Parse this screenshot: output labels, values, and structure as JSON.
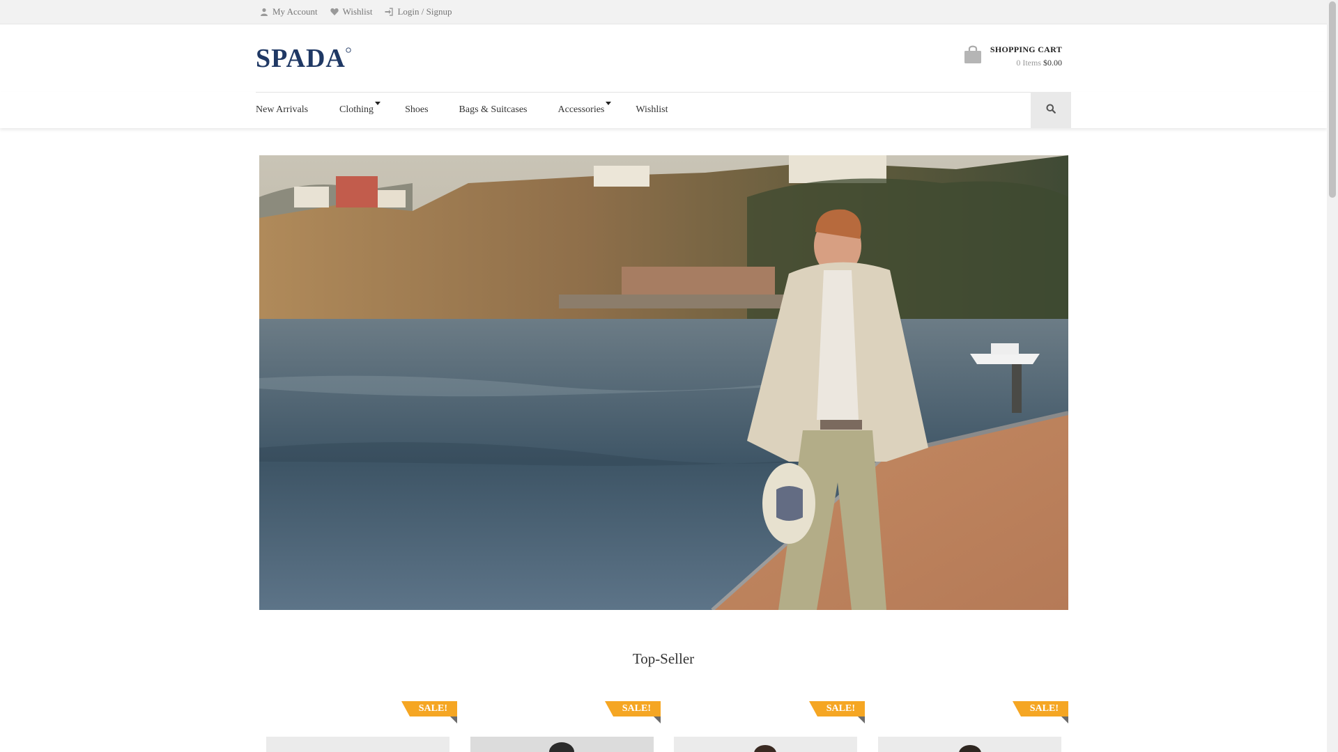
{
  "topbar": {
    "links": [
      {
        "label": "My Account",
        "icon": "user-icon"
      },
      {
        "label": "Wishlist",
        "icon": "heart-icon"
      },
      {
        "label": "Login / Signup",
        "icon": "sign-in-icon"
      }
    ]
  },
  "header": {
    "logo_text": "SPADA",
    "cart": {
      "title": "SHOPPING CART",
      "items": "0 Items",
      "total": "$0.00",
      "icon": "shopping-bag-icon"
    }
  },
  "nav": {
    "items": [
      {
        "label": "New Arrivals",
        "dropdown": false
      },
      {
        "label": "Clothing",
        "dropdown": true
      },
      {
        "label": "Shoes",
        "dropdown": false
      },
      {
        "label": "Bags & Suitcases",
        "dropdown": false
      },
      {
        "label": "Accessories",
        "dropdown": true
      },
      {
        "label": "Wishlist",
        "dropdown": false
      }
    ],
    "search_icon": "search-icon"
  },
  "hero": {
    "image": "man-in-linen-suit-on-pier"
  },
  "section": {
    "title": "Top-Seller"
  },
  "products": [
    {
      "badge": "SALE!"
    },
    {
      "badge": "SALE!"
    },
    {
      "badge": "SALE!"
    },
    {
      "badge": "SALE!"
    }
  ],
  "colors": {
    "sale_badge": "#f5a623",
    "logo": "#1f3864",
    "topbar_bg": "#f2f2f2"
  }
}
